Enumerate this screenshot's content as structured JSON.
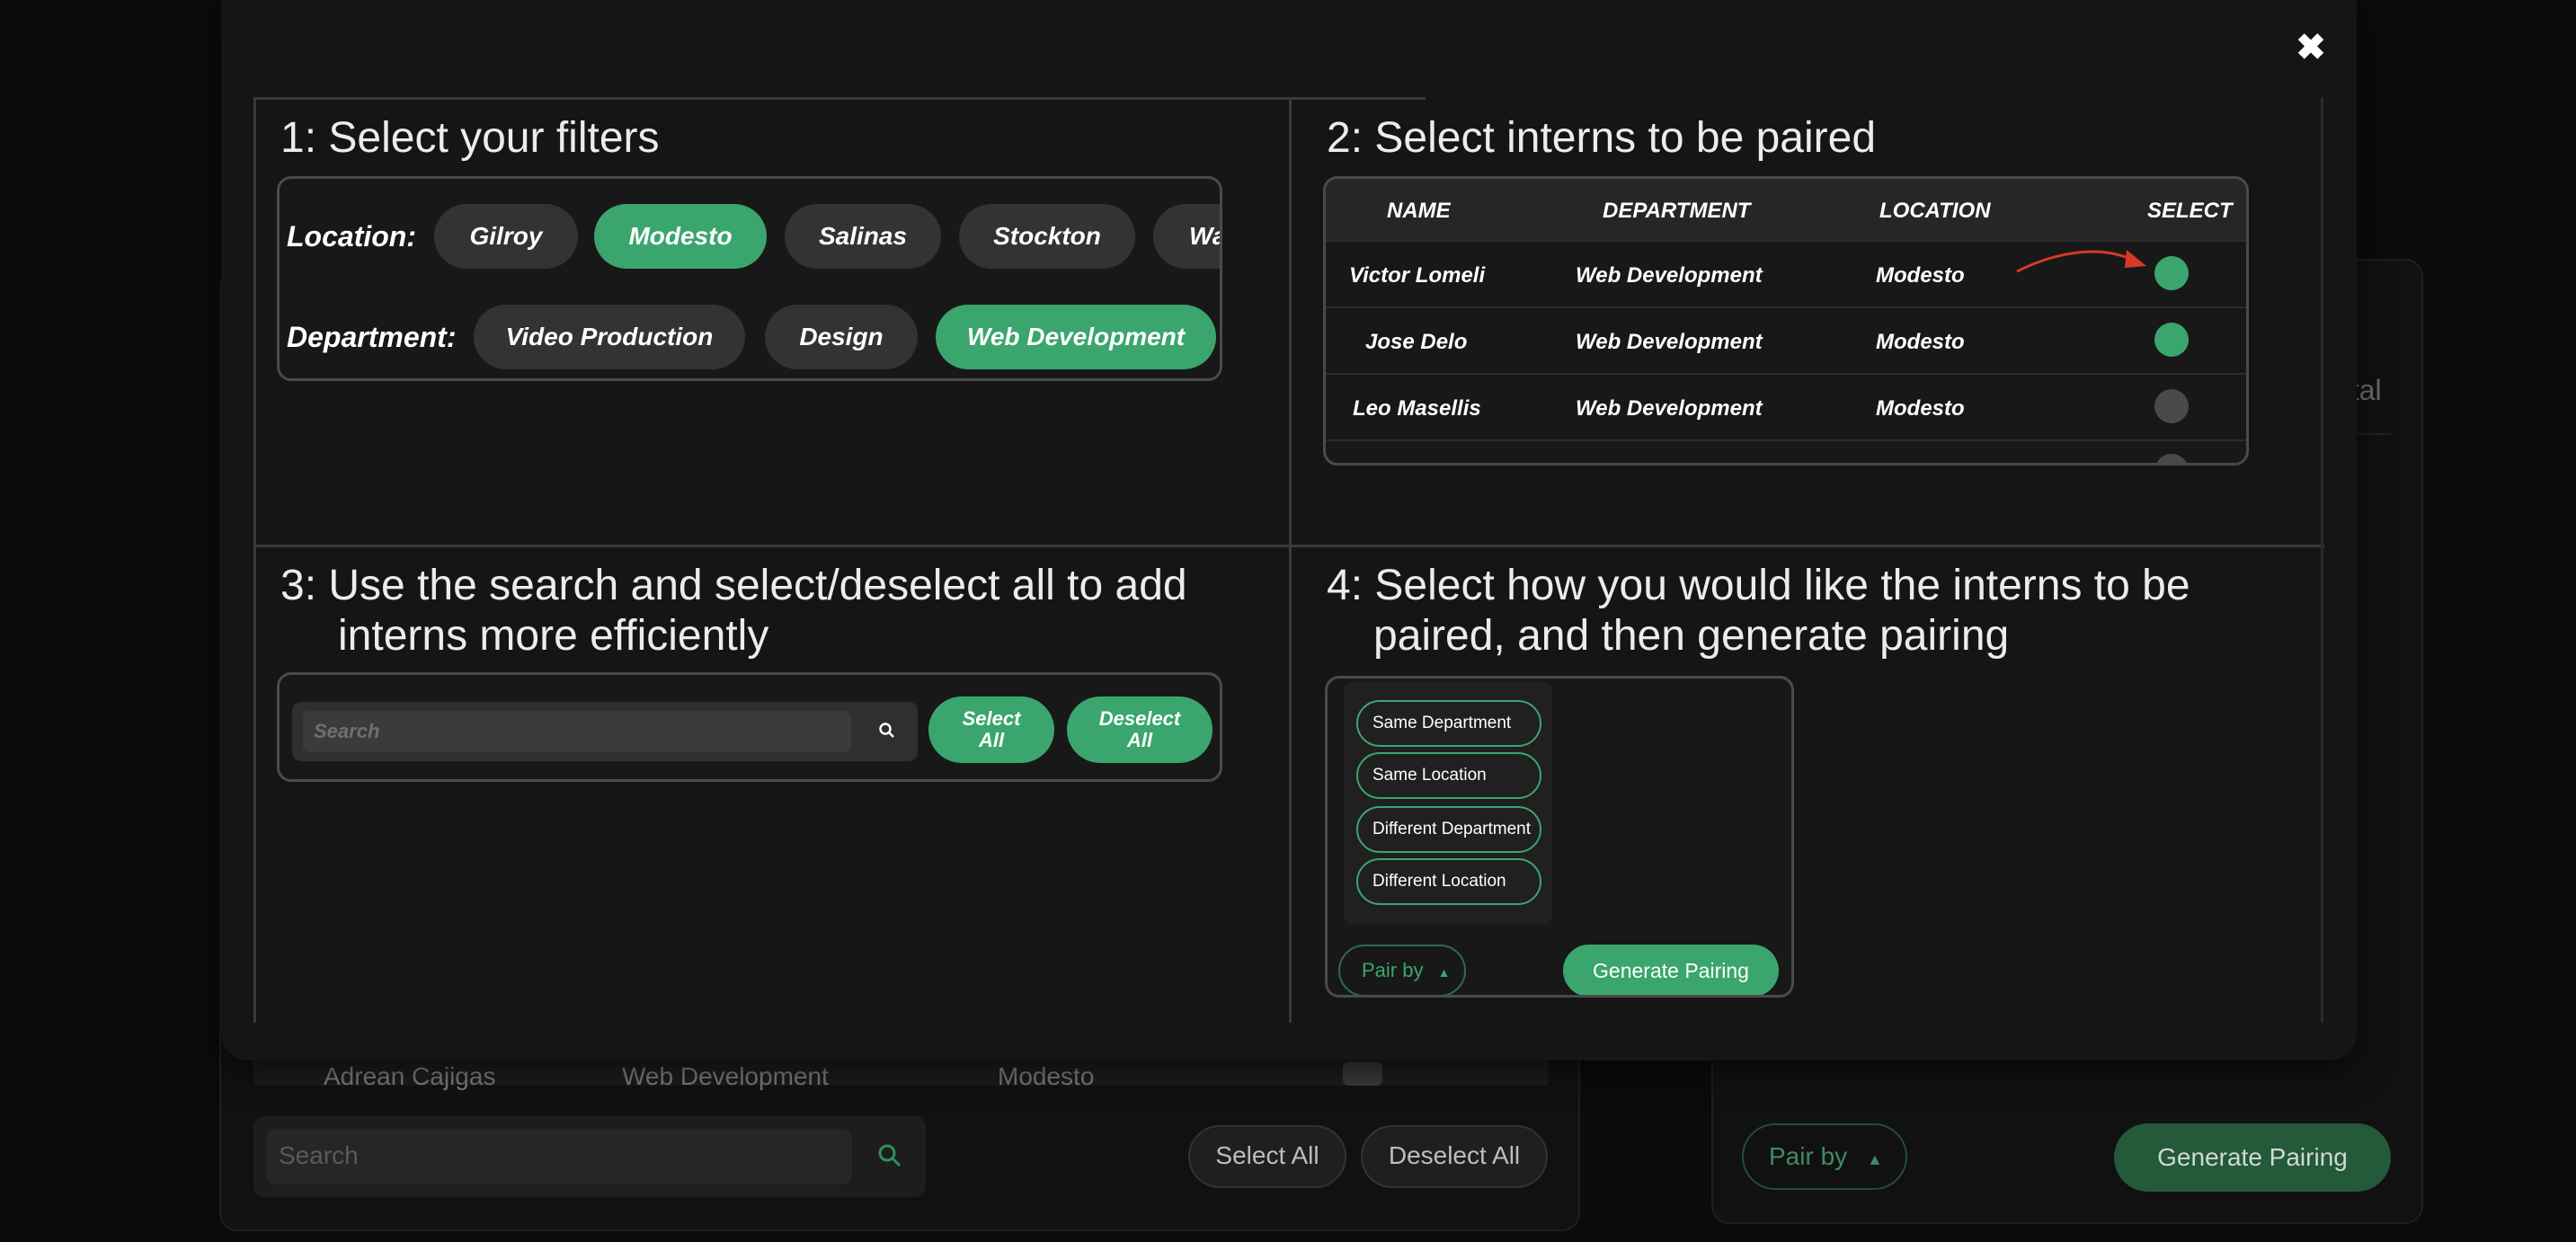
{
  "background": {
    "row": {
      "name": "Adrean Cajigas",
      "department": "Web Development",
      "location": "Modesto"
    },
    "search_placeholder": "Search",
    "select_all": "Select All",
    "deselect_all": "Deselect All",
    "total_fragment": "otal",
    "pair_by": "Pair by",
    "pair_by_arrow": "▲",
    "generate_pairing": "Generate Pairing"
  },
  "modal": {
    "close_icon": "✖",
    "step1": {
      "title": "1: Select your filters",
      "location_label": "Location:",
      "locations": [
        {
          "label": "Gilroy",
          "active": false
        },
        {
          "label": "Modesto",
          "active": true
        },
        {
          "label": "Salinas",
          "active": false
        },
        {
          "label": "Stockton",
          "active": false
        },
        {
          "label": "Wa",
          "active": false
        }
      ],
      "department_label": "Department:",
      "departments": [
        {
          "label": "Video Production",
          "active": false
        },
        {
          "label": "Design",
          "active": false
        },
        {
          "label": "Web Development",
          "active": true
        }
      ]
    },
    "step2": {
      "title": "2: Select interns to be paired",
      "columns": [
        "NAME",
        "DEPARTMENT",
        "LOCATION",
        "SELECT"
      ],
      "rows": [
        {
          "name": "Victor Lomeli",
          "department": "Web Development",
          "location": "Modesto",
          "selected": true
        },
        {
          "name": "Jose Delo",
          "department": "Web Development",
          "location": "Modesto",
          "selected": true
        },
        {
          "name": "Leo Masellis",
          "department": "Web Development",
          "location": "Modesto",
          "selected": false
        }
      ],
      "accent": "#d63a24"
    },
    "step3": {
      "title_line1": "3: Use the search and select/deselect all to add",
      "title_line2": "interns more efficiently",
      "search_placeholder": "Search",
      "search_icon": "search-icon",
      "select_all_line1": "Select",
      "select_all_line2": "All",
      "deselect_all_line1": "Deselect",
      "deselect_all_line2": "All"
    },
    "step4": {
      "title_line1": "4: Select how you would like the interns to be",
      "title_line2": "paired, and then generate pairing",
      "options": [
        "Same Department",
        "Same Location",
        "Different Department",
        "Different Location"
      ],
      "pair_by": "Pair by",
      "pair_by_arrow": "▲",
      "generate": "Generate Pairing"
    }
  },
  "colors": {
    "accent_green": "#3aa66d",
    "chip_gray": "#333333",
    "background": "#0b0b0b"
  }
}
